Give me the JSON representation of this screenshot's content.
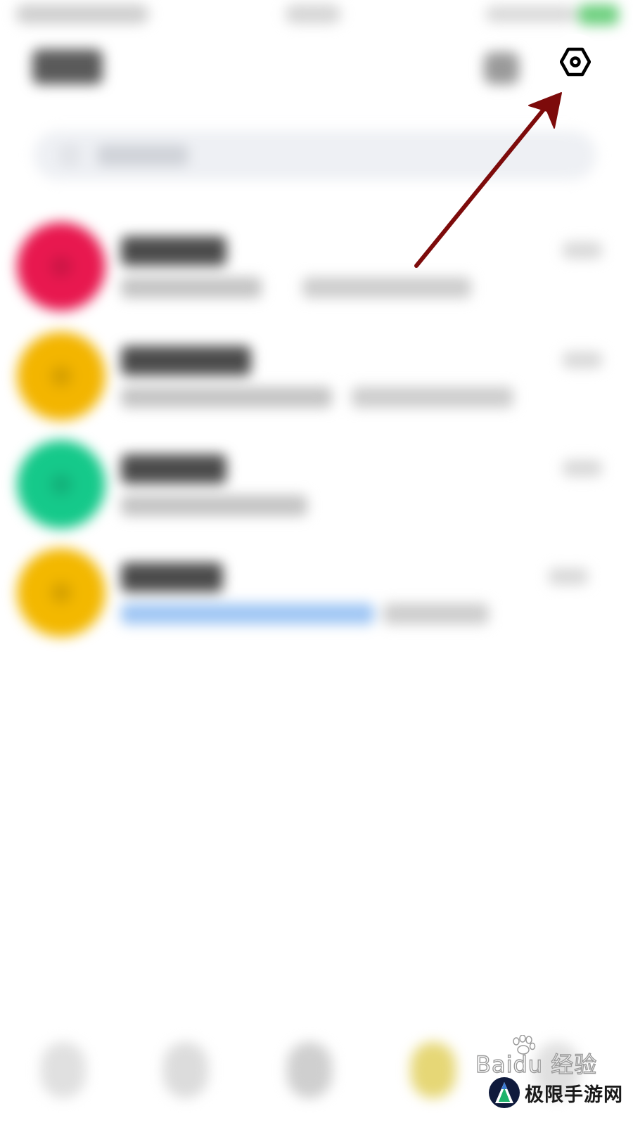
{
  "settings_icon": "settings-hex-nut-icon",
  "annotation": {
    "arrow_color": "#7d0b0b",
    "points_to": "settings-button"
  },
  "colors": {
    "avatar_1": "#e8184f",
    "avatar_2": "#f3b500",
    "avatar_3": "#15c98a",
    "avatar_4": "#f3b800",
    "link_accent": "#9fc6f4",
    "battery": "#6ed07f"
  },
  "conversations": [
    {
      "avatar_icon": "avatar-red-icon"
    },
    {
      "avatar_icon": "avatar-yellow-icon"
    },
    {
      "avatar_icon": "avatar-green-icon"
    },
    {
      "avatar_icon": "avatar-yellow-icon"
    }
  ],
  "watermark": {
    "baidu_text": "Baidu 经验",
    "brand_text": "极限手游网"
  }
}
